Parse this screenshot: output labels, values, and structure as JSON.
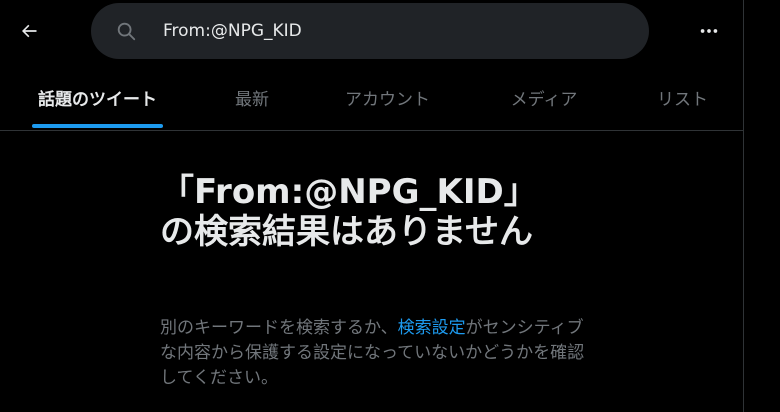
{
  "header": {
    "back_icon": "arrow-left-icon",
    "search": {
      "icon": "search-icon",
      "value": "From:@NPG_KID"
    },
    "more_icon": "ellipsis-icon"
  },
  "tabs": [
    {
      "label": "話題のツイート",
      "active": true
    },
    {
      "label": "最新",
      "active": false
    },
    {
      "label": "アカウント",
      "active": false
    },
    {
      "label": "メディア",
      "active": false
    },
    {
      "label": "リスト",
      "active": false
    }
  ],
  "empty_state": {
    "title": "「From:@NPG_KID」の検索結果はありません",
    "description_before": "別のキーワードを検索するか、",
    "description_link": "検索設定",
    "description_after": "がセンシティブな内容から保護する設定になっていないかどうかを確認してください。"
  },
  "colors": {
    "background": "#000000",
    "search_bg": "#202327",
    "text_primary": "#e7e9ea",
    "text_secondary": "#71767b",
    "accent": "#1d9bf0",
    "divider": "#2f3336"
  }
}
